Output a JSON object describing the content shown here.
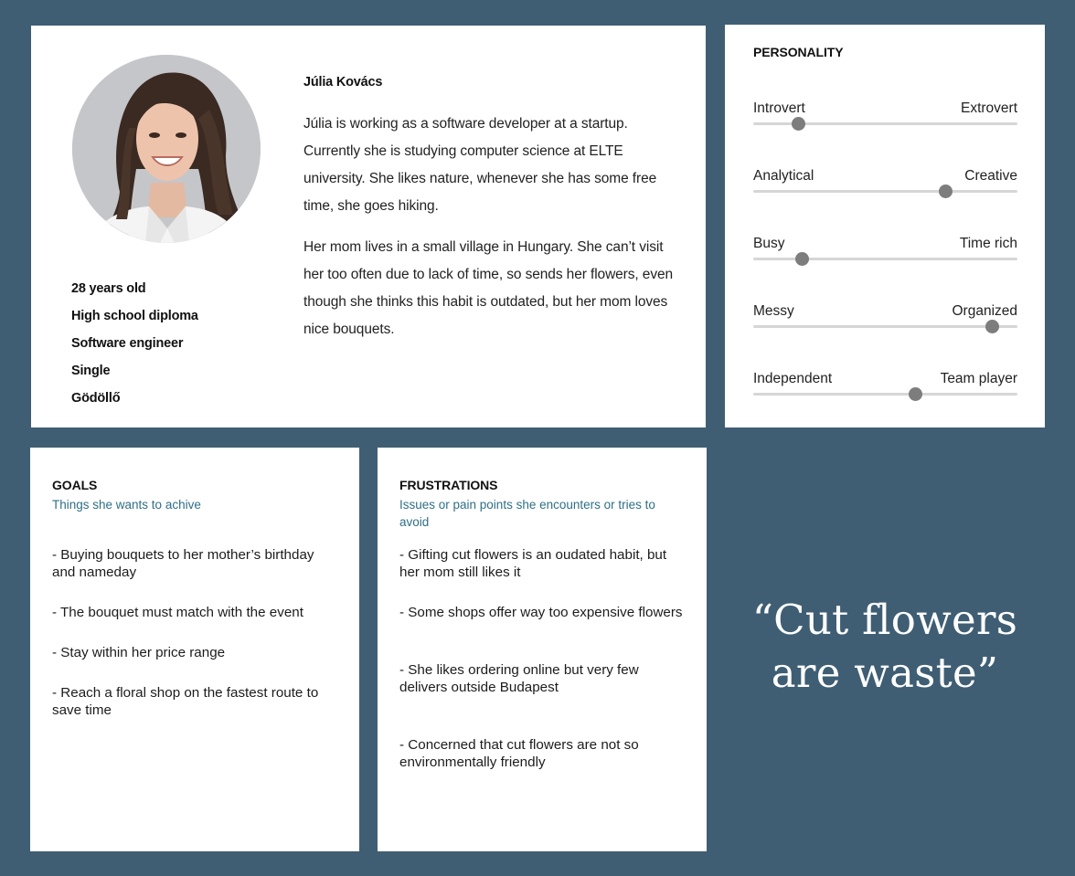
{
  "colors": {
    "background": "#3f5e74",
    "card": "#ffffff",
    "accent_text": "#2f6f86",
    "slider_track": "#d6d6d6",
    "slider_knob": "#7d7d7d"
  },
  "profile": {
    "name": "Júlia Kovács",
    "photo_icon": "portrait-photo",
    "facts": [
      "28 years old",
      "High school diploma",
      "Software engineer",
      "Single",
      "Gödöllő"
    ],
    "bio": [
      "Júlia is working as a software developer at a startup. Currently she is studying computer science at ELTE university. She likes nature, whenever she has some free time, she goes hiking.",
      "Her mom lives in a small village in Hungary. She can’t visit her too often due to lack of time, so sends her flowers, even though she thinks this habit is outdated, but her mom loves nice bouquets."
    ]
  },
  "personality": {
    "title": "PERSONALITY",
    "traits": [
      {
        "left": "Introvert",
        "right": "Extrovert",
        "value": 0.17
      },
      {
        "left": "Analytical",
        "right": "Creative",
        "value": 0.73
      },
      {
        "left": "Busy",
        "right": "Time rich",
        "value": 0.185
      },
      {
        "left": "Messy",
        "right": "Organized",
        "value": 0.905
      },
      {
        "left": "Independent",
        "right": "Team player",
        "value": 0.615
      }
    ]
  },
  "goals": {
    "title": "GOALS",
    "subtitle": "Things she wants to achive",
    "items": [
      "- Buying bouquets to her mother’s birthday and nameday",
      "- The bouquet must match with the event",
      "- Stay within her price range",
      "- Reach a floral shop on the fastest route to save time"
    ]
  },
  "frustrations": {
    "title": "FRUSTRATIONS",
    "subtitle": "Issues or pain points she encounters or tries to avoid",
    "items": [
      "- Gifting cut flowers is an oudated habit, but her mom still likes it",
      "- Some shops offer way too expensive flowers",
      "- She likes ordering online but very few delivers outside Budapest",
      "- Concerned that cut flowers are not so environmentally friendly"
    ]
  },
  "quote": {
    "line1": "“Cut flowers",
    "line2": "are waste”"
  }
}
